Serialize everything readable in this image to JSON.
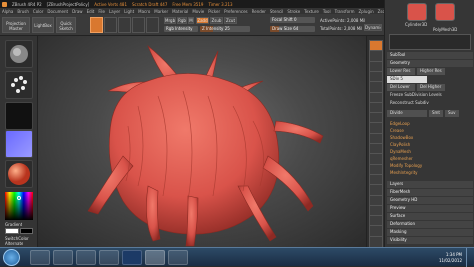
{
  "title_bar": {
    "app": "ZBrush 4R4 P2",
    "project": "[ZBrushProjectPolicy]",
    "active_points": "Active Verts 481",
    "tool": "Scratch Draft 447",
    "free_mem": "Free Mem 3519",
    "timer": "Timer 3.213",
    "buttons": [
      "Menus",
      "DefaultZScript"
    ]
  },
  "menu_bar": [
    "Alpha",
    "Brush",
    "Color",
    "Document",
    "Draw",
    "Edit",
    "File",
    "Layer",
    "Light",
    "Macro",
    "Marker",
    "Material",
    "Movie",
    "Picker",
    "Preferences",
    "Render",
    "Stencil",
    "Stroke",
    "Texture",
    "Tool",
    "Transform",
    "Zplugin",
    "Zscript"
  ],
  "shelf": {
    "projection_master": "Projection Master",
    "lightbox": "LightBox",
    "quick_sketch": "Quick Sketch",
    "mode_buttons": [
      "Edit",
      "Draw",
      "Move",
      "Scale",
      "Rotate"
    ],
    "mrgb": "Mrgb",
    "rgb": "Rgb",
    "m": "M",
    "zadd": "Zadd",
    "zsub": "Zsub",
    "zcut": "Zcut",
    "rgb_intensity": "Rgb Intensity",
    "z_intensity": "Z Intensity 25",
    "focal_shift": "Focal Shift 0",
    "draw_size": "Draw Size 64",
    "active_points": "ActivePoints: 2,008 Mil",
    "total_points": "TotalPoints: 2,008 Mil",
    "dynamic": "Dynamic"
  },
  "left_shelf": {
    "brush_label": "Standard",
    "stroke_label": "Dots",
    "alpha_label": "Alpha Off",
    "texture_label": "Texture Off",
    "material_label": "SkinShade4",
    "gradient": "Gradient",
    "switch_color": "SwitchColor",
    "alternate": "Alternate"
  },
  "right_tray": {
    "top_labels": [
      "Cylinder3D",
      "PolyMesh3D"
    ],
    "subtool": "SubTool",
    "geometry": "Geometry",
    "lower_res": "Lower Res",
    "higher_res": "Higher Res",
    "sdiv": "SDiv 5",
    "del_lower": "Del Lower",
    "del_higher": "Del Higher",
    "freeze": "Freeze SubDivision Levels",
    "reconstruct": "Reconstruct Subdiv",
    "divide": "Divide",
    "smt": "Smt",
    "suv": "Suv",
    "edgeloop": "EdgeLoop",
    "crease": "Crease",
    "shadowbox": "ShadowBox",
    "clay_polish": "ClayPolish",
    "dynamesh": "DynaMesh",
    "qremesher": "qRemesher",
    "modify_topology": "Modify Topology",
    "mesh_integrity": "MeshIntegrity",
    "layers": "Layers",
    "fibermesh": "FiberMesh",
    "geometry_hd": "Geometry HD",
    "preview": "Preview",
    "surface": "Surface",
    "deformation": "Deformation",
    "masking": "Masking",
    "visibility": "Visibility"
  },
  "viewport_tools": [
    "BPR",
    "SPix 3",
    "Scroll",
    "Zoom",
    "Actual",
    "AAHalf",
    "Persp",
    "Floor",
    "Local",
    "LSym",
    "Xyz",
    "Frame",
    "Move",
    "Scale",
    "Rotate",
    "PolyF",
    "Transp",
    "Ghost",
    "Solo",
    "Xpose"
  ],
  "taskbar": {
    "apps": [
      "Start",
      "Explorer",
      "Media",
      "Explorer",
      "Chrome",
      "Photoshop",
      "ZBrush",
      "Firefox"
    ],
    "clock_time": "1:34 PM",
    "clock_date": "11/02/2012"
  },
  "colors": {
    "accent": "#d9782f",
    "hair": "#d9534a",
    "menu_bg": "#333333"
  }
}
